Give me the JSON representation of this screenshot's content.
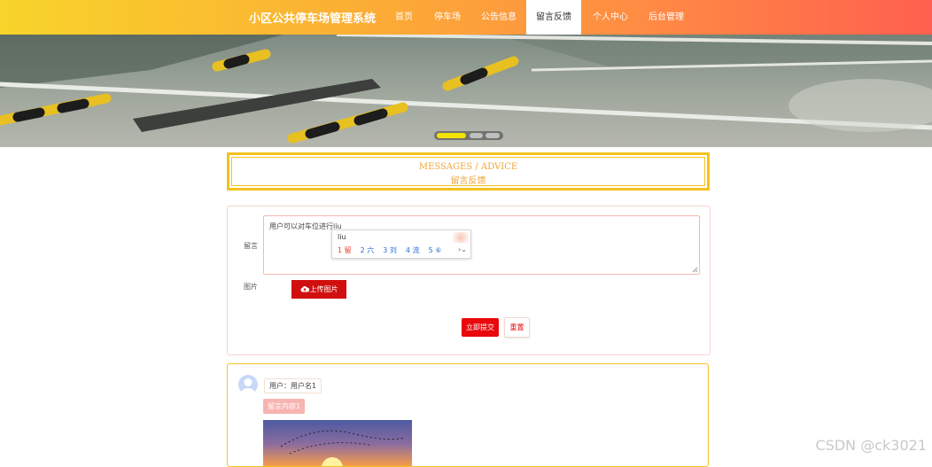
{
  "app": {
    "title": "小区公共停车场管理系统"
  },
  "nav": {
    "items": [
      {
        "label": "首页"
      },
      {
        "label": "停车场"
      },
      {
        "label": "公告信息"
      },
      {
        "label": "留言反馈"
      },
      {
        "label": "个人中心"
      },
      {
        "label": "后台管理"
      }
    ],
    "active": "留言反馈"
  },
  "carousel": {
    "slide_count": 3,
    "active_slide": 1
  },
  "section": {
    "title_en": "MESSAGES / ADVICE",
    "title_cn": "留言反馈"
  },
  "form": {
    "message_label": "留言",
    "message_value": "用户可以对车位进行liu",
    "image_label": "图片",
    "upload_label": "上传图片",
    "submit_label": "立即提交",
    "reset_label": "重置"
  },
  "ime": {
    "composition": "liu",
    "candidates": [
      "1 留",
      "2 六",
      "3 刘",
      "4 流",
      "5 ⑥"
    ]
  },
  "message": {
    "user_label": "用户：用户名1",
    "content_label": "留言内容1"
  },
  "watermark": "CSDN @ck3021",
  "colors": {
    "accent_red": "#e9080c",
    "title_gold": "#f4c21f",
    "nav_gradient_start": "#f8d42a",
    "nav_gradient_end": "#ff5f4f"
  }
}
